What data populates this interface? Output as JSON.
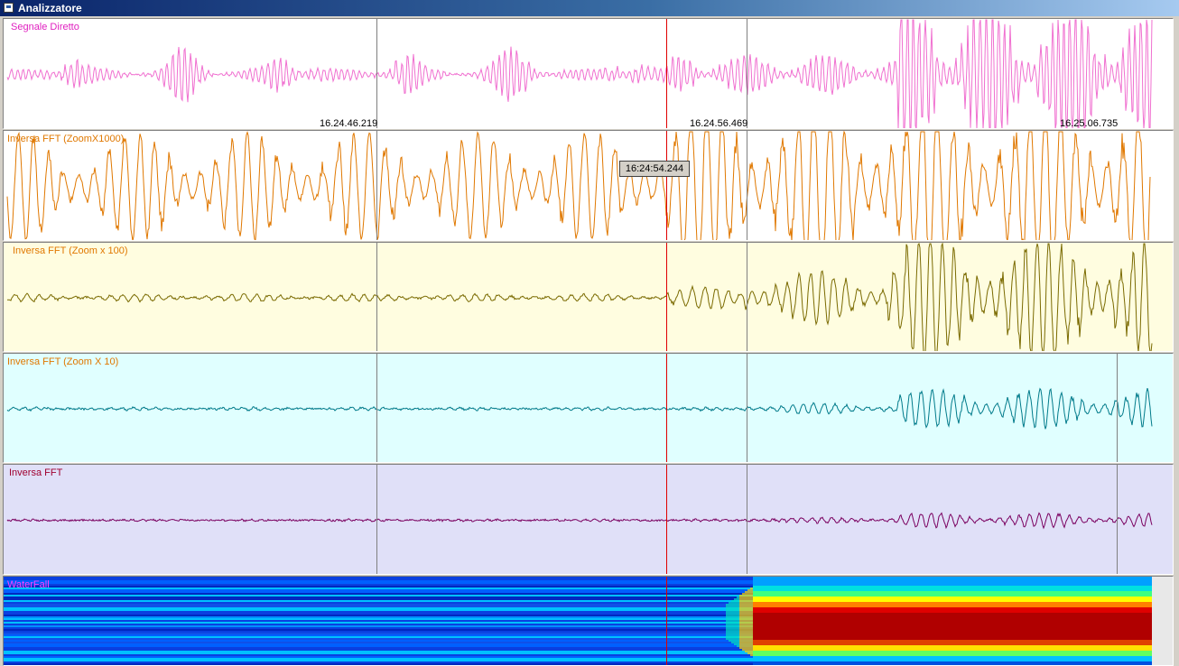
{
  "window": {
    "title": "Analizzatore",
    "icon": "window-icon"
  },
  "panels": [
    {
      "id": "segnale-diretto",
      "label": "Segnale Diretto",
      "label_color": "#e020c0",
      "bg": "#ffffff",
      "trace_color": "#f070d0"
    },
    {
      "id": "inversa-fft-zoom1000",
      "label": "Inversa FFT (ZoomX1000)",
      "label_color": "#e07800",
      "bg": "#ffffff",
      "trace_color": "#e07800"
    },
    {
      "id": "inversa-fft-zoom100",
      "label": "Inversa FFT (Zoom x 100)",
      "label_color": "#e07800",
      "bg": "#fffde0",
      "trace_color": "#7a6a00"
    },
    {
      "id": "inversa-fft-zoom10",
      "label": "Inversa FFT (Zoom X 10)",
      "label_color": "#e07800",
      "bg": "#e0ffff",
      "trace_color": "#007a8a"
    },
    {
      "id": "inversa-fft",
      "label": "Inversa FFT",
      "label_color": "#a00030",
      "bg": "#e0e0f8",
      "trace_color": "#7a0060"
    }
  ],
  "waterfall": {
    "label": "WaterFall",
    "label_color": "#ff40ff"
  },
  "time_labels": [
    "16.24.46.219",
    "16.24.56.469",
    "16.25.06.735"
  ],
  "cursor": {
    "time": "16:24:54.244",
    "color": "#e00000"
  }
}
